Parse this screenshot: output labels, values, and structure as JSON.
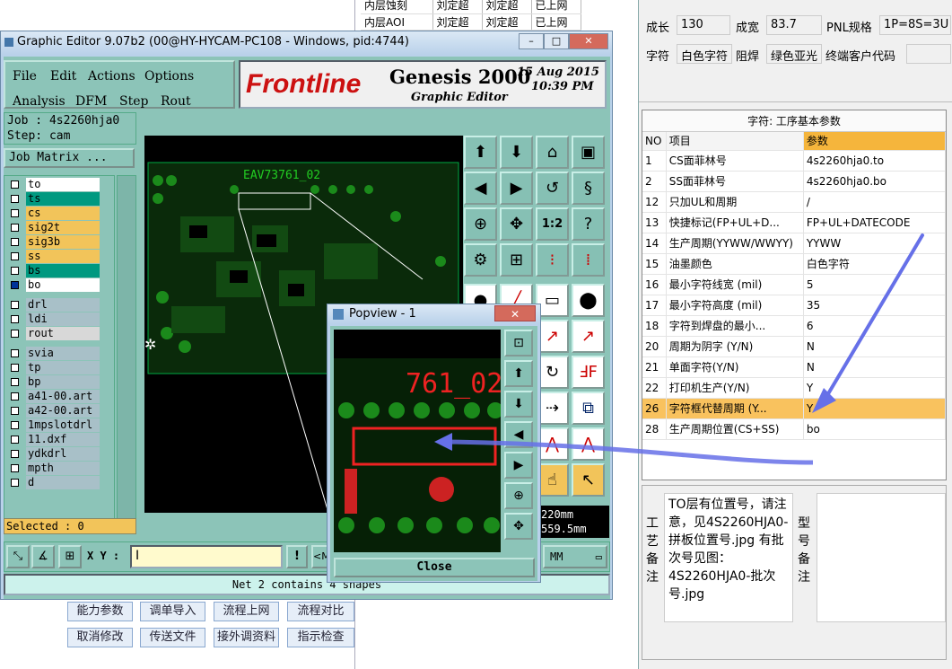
{
  "bg_table_rows": [
    {
      "a": "内层蚀刻",
      "b": "刘定超",
      "c": "刘定超",
      "d": "已上网"
    },
    {
      "a": "内层AOI",
      "b": "刘定超",
      "c": "刘定超",
      "d": "已上网"
    }
  ],
  "top_fields": {
    "chengzhang_label": "成长",
    "chengzhang_value": "130",
    "chengkuan_label": "成宽",
    "chengkuan_value": "83.7",
    "pnl_label": "PNL规格",
    "pnl_value": "1P=8S=3U",
    "zifu_label": "字符",
    "zifu_value": "白色字符",
    "zuhan_label": "阻焊",
    "zuhan_value": "绿色亚光",
    "customer_label": "终端客户代码",
    "customer_value": ""
  },
  "params": {
    "title": "字符: 工序基本参数",
    "headers": [
      "NO",
      "项目",
      "参数"
    ],
    "rows": [
      {
        "no": "1",
        "item": "CS面菲林号",
        "val": "4s2260hja0.to"
      },
      {
        "no": "2",
        "item": "SS面菲林号",
        "val": "4s2260hja0.bo"
      },
      {
        "no": "12",
        "item": "只加UL和周期",
        "val": "/"
      },
      {
        "no": "13",
        "item": "快捷标记(FP+UL+D...",
        "val": "FP+UL+DATECODE"
      },
      {
        "no": "14",
        "item": "生产周期(YYWW/WWYY)",
        "val": "YYWW"
      },
      {
        "no": "15",
        "item": "油墨颜色",
        "val": "白色字符"
      },
      {
        "no": "16",
        "item": "最小字符线宽 (mil)",
        "val": "5"
      },
      {
        "no": "17",
        "item": "最小字符高度 (mil)",
        "val": "35"
      },
      {
        "no": "18",
        "item": "字符到焊盘的最小...",
        "val": "6"
      },
      {
        "no": "20",
        "item": "周期为阴字 (Y/N)",
        "val": "N"
      },
      {
        "no": "21",
        "item": "单面字符(Y/N)",
        "val": "N"
      },
      {
        "no": "22",
        "item": "打印机生产(Y/N)",
        "val": "Y"
      },
      {
        "no": "26",
        "item": "字符框代替周期 (Y...",
        "val": "Y"
      },
      {
        "no": "28",
        "item": "生产周期位置(CS+SS)",
        "val": "bo"
      }
    ]
  },
  "notes": {
    "label1": "工艺备注",
    "text1": "TO层有位置号，请注意，见4S2260HJA0-拼板位置号.jpg 有批次号见图：4S2260HJA0-批次号.jpg",
    "label2": "型号备注"
  },
  "bottom_buttons": [
    "能力参数",
    "调单导入",
    "流程上网",
    "流程对比",
    "取消修改",
    "传送文件",
    "接外调资料",
    "指示检查"
  ],
  "genesis": {
    "title": "Graphic Editor 9.07b2 (00@HY-HYCAM-PC108 - Windows, pid:4744)",
    "menu": [
      "File",
      "Edit",
      "Actions",
      "Options",
      "Analysis",
      "DFM",
      "Step",
      "Rout"
    ],
    "logo": "Frontline",
    "product": "Genesis 2000",
    "subtitle": "Graphic Editor",
    "date": "15 Aug 2015",
    "time": "10:39 PM",
    "job": "Job : 4s2260hja0",
    "step": "Step: cam",
    "job_matrix": "Job Matrix ...",
    "layers": [
      {
        "name": "to",
        "color": "#ffffff"
      },
      {
        "name": "ts",
        "color": "#009980"
      },
      {
        "name": "cs",
        "color": "#f2c45a"
      },
      {
        "name": "sig2t",
        "color": "#f2c45a"
      },
      {
        "name": "sig3b",
        "color": "#f2c45a"
      },
      {
        "name": "ss",
        "color": "#f2c45a"
      },
      {
        "name": "bs",
        "color": "#009980"
      },
      {
        "name": "bo",
        "color": "#ffffff"
      },
      {
        "name": "drl",
        "color": "#a8c0c8"
      },
      {
        "name": "ldi",
        "color": "#a8c0c8"
      },
      {
        "name": "rout",
        "color": "#d8d8d8"
      },
      {
        "name": "svia",
        "color": "#a8c0c8"
      },
      {
        "name": "tp",
        "color": "#a8c0c8"
      },
      {
        "name": "bp",
        "color": "#a8c0c8"
      },
      {
        "name": "a41-00.art",
        "color": "#a8c0c8"
      },
      {
        "name": "a42-00.art",
        "color": "#a8c0c8"
      },
      {
        "name": "1mpslotdrl",
        "color": "#a8c0c8"
      },
      {
        "name": "11.dxf",
        "color": "#a8c0c8"
      },
      {
        "name": "ydkdrl",
        "color": "#a8c0c8"
      },
      {
        "name": "mpth",
        "color": "#a8c0c8"
      },
      {
        "name": "d",
        "color": "#a8c0c8"
      }
    ],
    "selected": "Selected : 0",
    "xy_label": "X Y :",
    "xy_value": "I",
    "coord1": "220mm",
    "coord2": "559.5mm",
    "units": "MM",
    "status": "Net 2 contains 4 shapes",
    "pcb_text": "EAV73761_02"
  },
  "popview": {
    "title": "Popview - 1",
    "text_top": "761_02",
    "close_label": "Close"
  }
}
